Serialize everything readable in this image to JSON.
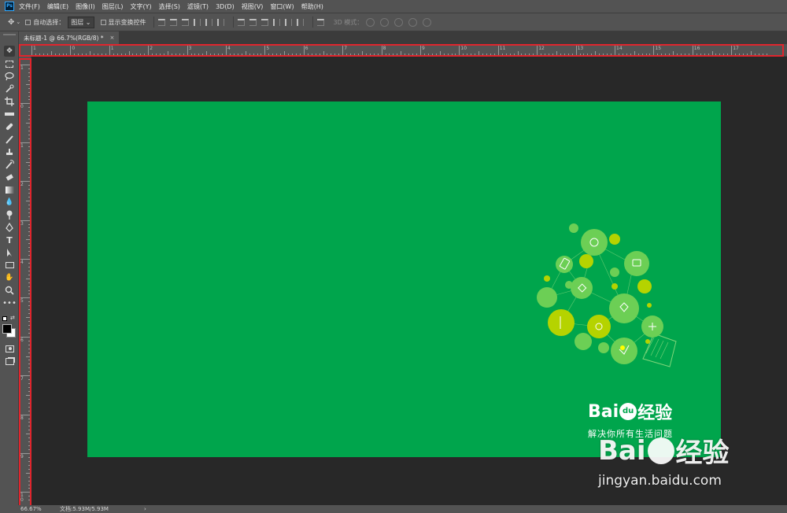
{
  "app": {
    "logo": "Ps"
  },
  "menu": [
    "文件(F)",
    "编辑(E)",
    "图像(I)",
    "图层(L)",
    "文字(Y)",
    "选择(S)",
    "滤镜(T)",
    "3D(D)",
    "视图(V)",
    "窗口(W)",
    "帮助(H)"
  ],
  "options": {
    "auto_select_label": "自动选择：",
    "auto_select_value": "图层",
    "transform_label": "显示变换控件",
    "mode3d_label": "3D 模式："
  },
  "document": {
    "tab_title": "未标题-1 @ 66.7%(RGB/8) *",
    "close": "×"
  },
  "rulers": {
    "h_ticks": [
      "1",
      "0",
      "1",
      "2",
      "3",
      "4",
      "5",
      "6",
      "7",
      "8",
      "9",
      "10",
      "11",
      "12",
      "13",
      "14",
      "15",
      "16",
      "17"
    ],
    "v_ticks": [
      "1",
      "0",
      "1",
      "2",
      "3",
      "4",
      "5",
      "6",
      "7",
      "8",
      "9",
      "1\n0"
    ]
  },
  "canvas": {
    "background": "#00a54c",
    "logo_brand_a": "Bai",
    "logo_brand_b": "经验",
    "logo_paw": "du",
    "slogan": "解决你所有生活问题"
  },
  "status": {
    "zoom": "66.67%",
    "doc_info": "文档:5.93M/5.93M",
    "arrow": "›"
  },
  "watermark": {
    "brand_a": "Bai",
    "brand_b": "经验",
    "url": "jingyan.baidu.com"
  },
  "colors": {
    "highlight": "#e0252d",
    "panel": "#535353",
    "workspace": "#282828"
  },
  "tools": [
    "move-icon",
    "marquee-icon",
    "lasso-icon",
    "quick-select-icon",
    "crop-icon",
    "eyedropper-icon",
    "healing-icon",
    "brush-icon",
    "stamp-icon",
    "history-brush-icon",
    "eraser-icon",
    "gradient-icon",
    "blur-icon",
    "dodge-icon",
    "pen-icon",
    "type-icon",
    "path-select-icon",
    "rectangle-icon",
    "hand-icon",
    "zoom-icon",
    "more-icon"
  ]
}
